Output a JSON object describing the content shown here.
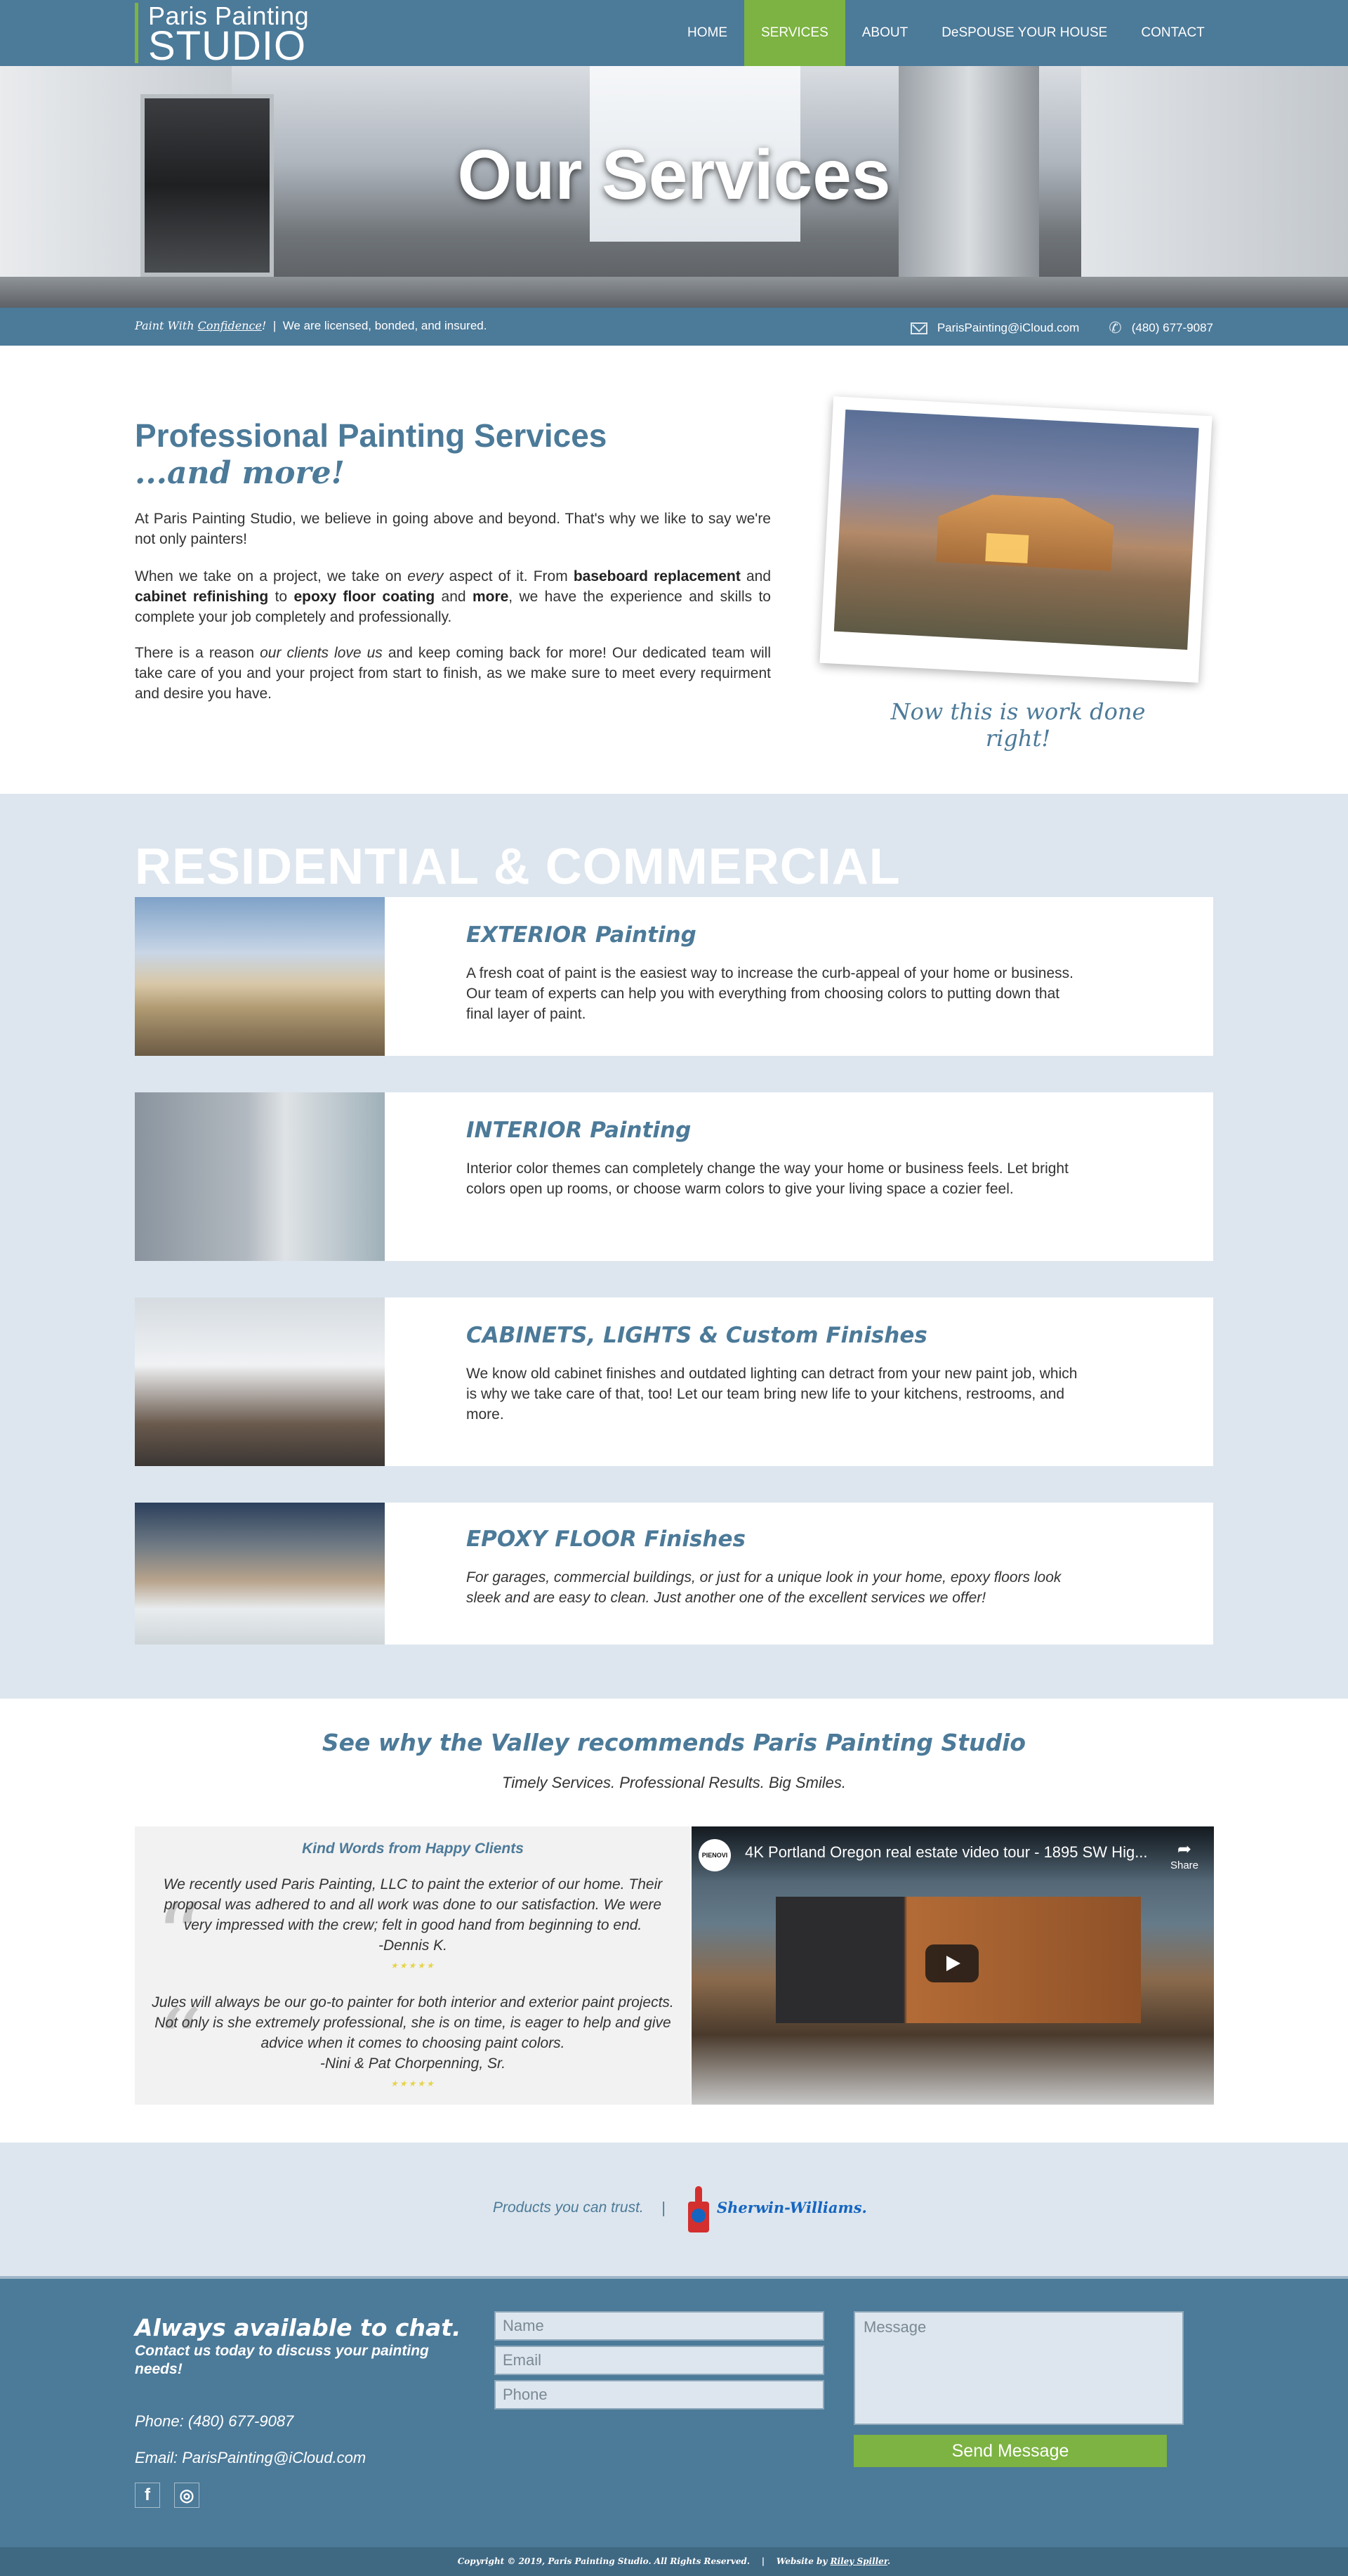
{
  "nav": {
    "logo_line1": "Paris Painting",
    "logo_line2": "STUDIO",
    "items": [
      {
        "label": "HOME"
      },
      {
        "label": "SERVICES",
        "active": true
      },
      {
        "label": "ABOUT"
      },
      {
        "label": "DeSPOUSE YOUR HOUSE"
      },
      {
        "label": "CONTACT"
      }
    ]
  },
  "hero": {
    "title": "Our Services"
  },
  "infobar": {
    "tag_prefix": "Paint With ",
    "tag_word": "Confidence",
    "tag_suffix": "!",
    "pipe": "|",
    "licensed": "We are licensed, bonded, and insured.",
    "email": "ParisPainting@iCloud.com",
    "phone": "(480) 677-9087",
    "mail_icon": "envelope-icon",
    "phone_icon": "phone-icon"
  },
  "intro": {
    "title": "Professional Painting Services",
    "subtitle": "...and more!",
    "p1": "At Paris Painting Studio, we believe in going above and beyond. That's why we like to say we're not only painters!",
    "p2": {
      "t1": "When we take on a project, we take on ",
      "every": "every",
      "t2": " aspect of it. From ",
      "b1": "baseboard replacement",
      "t3": " and ",
      "b2": "cabinet refinishing",
      "t4": " to ",
      "b3": "epoxy floor coating",
      "t5": " and ",
      "b4": "more",
      "t6": ", we have the experience and skills to complete your job completely and professionally."
    },
    "p3": {
      "t1": "There is a reason ",
      "em": "our clients love us",
      "t2": " and keep coming back for more! Our dedicated team will take care of you and your project from start to finish, as we make sure to meet every requirment and desire you have."
    },
    "caption": "Now this is work done right!"
  },
  "services": {
    "heading": "RESIDENTIAL & COMMERCIAL",
    "cards": [
      {
        "title": "EXTERIOR Painting",
        "text": "A fresh coat of paint is the easiest way to increase the curb-appeal of your home or business. Our team of experts can help you with everything from choosing colors to putting down that final layer of paint."
      },
      {
        "title": "INTERIOR Painting",
        "text": "Interior color themes can completely change the way your home or business feels. Let bright colors open up rooms, or choose warm colors to give your living space a cozier feel."
      },
      {
        "title": "CABINETS, LIGHTS & Custom Finishes",
        "text": "We know old cabinet finishes and outdated lighting can detract from your new paint job, which is why we take care of that, too! Let our team bring new life to your kitchens, restrooms, and more."
      },
      {
        "title": "EPOXY FLOOR Finishes",
        "text": "For garages, commercial buildings, or just for a unique look in your home, epoxy floors look sleek and are easy to clean. Just another one of the excellent services we offer!"
      }
    ]
  },
  "testimonials": {
    "heading": "See why the Valley recommends Paris Painting Studio",
    "subheading": "Timely Services. Professional Results. Big Smiles.",
    "box_title": "Kind Words from Happy Clients",
    "quotes": [
      {
        "text": "We recently used Paris Painting, LLC to paint the exterior of our home. Their proposal was adhered to and all work was done to our satisfaction. We were very impressed with the crew; felt in good hand from beginning to end.",
        "author": "-Dennis K.",
        "stars": "★★★★★"
      },
      {
        "text": "Jules will always be our go-to painter for both interior and exterior paint projects. Not only is she extremely professional, she is on time, is eager to help and give advice when it comes to choosing paint colors.",
        "author": "-Nini & Pat Chorpenning, Sr.",
        "stars": "★★★★★"
      }
    ],
    "video": {
      "channel": "PIENOVI",
      "title": "4K Portland Oregon real estate video tour - 1895 SW Hig...",
      "share": "Share"
    }
  },
  "products": {
    "text": "Products you can trust.",
    "sep": "|",
    "brand": "Sherwin-Williams."
  },
  "footer": {
    "heading": "Always available to chat.",
    "sub": "Contact us today to discuss your painting needs!",
    "phone": "Phone: (480) 677-9087",
    "email": "Email: ParisPainting@iCloud.com",
    "form": {
      "name_placeholder": "Name",
      "email_placeholder": "Email",
      "phone_placeholder": "Phone",
      "message_placeholder": "Message",
      "send_label": "Send Message"
    },
    "social": [
      "f",
      "◎"
    ],
    "copyright": "Copyright © 2019, Paris Painting Studio. All Rights Reserved.",
    "pipe": "|",
    "credit_prefix": "Website by ",
    "credit_name": "Riley Spiller",
    "credit_suffix": "."
  },
  "colors": {
    "brand_blue": "#4c7a99",
    "accent_green": "#7cb342",
    "light_bg": "#dde6ee"
  }
}
